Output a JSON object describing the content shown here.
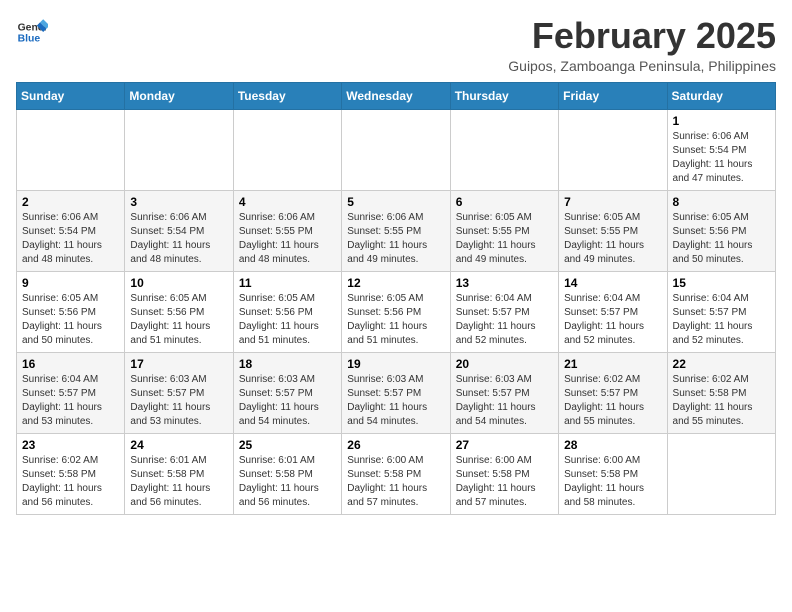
{
  "header": {
    "logo_line1": "General",
    "logo_line2": "Blue",
    "month_title": "February 2025",
    "subtitle": "Guipos, Zamboanga Peninsula, Philippines"
  },
  "weekdays": [
    "Sunday",
    "Monday",
    "Tuesday",
    "Wednesday",
    "Thursday",
    "Friday",
    "Saturday"
  ],
  "weeks": [
    [
      {
        "day": "",
        "info": ""
      },
      {
        "day": "",
        "info": ""
      },
      {
        "day": "",
        "info": ""
      },
      {
        "day": "",
        "info": ""
      },
      {
        "day": "",
        "info": ""
      },
      {
        "day": "",
        "info": ""
      },
      {
        "day": "1",
        "info": "Sunrise: 6:06 AM\nSunset: 5:54 PM\nDaylight: 11 hours\nand 47 minutes."
      }
    ],
    [
      {
        "day": "2",
        "info": "Sunrise: 6:06 AM\nSunset: 5:54 PM\nDaylight: 11 hours\nand 48 minutes."
      },
      {
        "day": "3",
        "info": "Sunrise: 6:06 AM\nSunset: 5:54 PM\nDaylight: 11 hours\nand 48 minutes."
      },
      {
        "day": "4",
        "info": "Sunrise: 6:06 AM\nSunset: 5:55 PM\nDaylight: 11 hours\nand 48 minutes."
      },
      {
        "day": "5",
        "info": "Sunrise: 6:06 AM\nSunset: 5:55 PM\nDaylight: 11 hours\nand 49 minutes."
      },
      {
        "day": "6",
        "info": "Sunrise: 6:05 AM\nSunset: 5:55 PM\nDaylight: 11 hours\nand 49 minutes."
      },
      {
        "day": "7",
        "info": "Sunrise: 6:05 AM\nSunset: 5:55 PM\nDaylight: 11 hours\nand 49 minutes."
      },
      {
        "day": "8",
        "info": "Sunrise: 6:05 AM\nSunset: 5:56 PM\nDaylight: 11 hours\nand 50 minutes."
      }
    ],
    [
      {
        "day": "9",
        "info": "Sunrise: 6:05 AM\nSunset: 5:56 PM\nDaylight: 11 hours\nand 50 minutes."
      },
      {
        "day": "10",
        "info": "Sunrise: 6:05 AM\nSunset: 5:56 PM\nDaylight: 11 hours\nand 51 minutes."
      },
      {
        "day": "11",
        "info": "Sunrise: 6:05 AM\nSunset: 5:56 PM\nDaylight: 11 hours\nand 51 minutes."
      },
      {
        "day": "12",
        "info": "Sunrise: 6:05 AM\nSunset: 5:56 PM\nDaylight: 11 hours\nand 51 minutes."
      },
      {
        "day": "13",
        "info": "Sunrise: 6:04 AM\nSunset: 5:57 PM\nDaylight: 11 hours\nand 52 minutes."
      },
      {
        "day": "14",
        "info": "Sunrise: 6:04 AM\nSunset: 5:57 PM\nDaylight: 11 hours\nand 52 minutes."
      },
      {
        "day": "15",
        "info": "Sunrise: 6:04 AM\nSunset: 5:57 PM\nDaylight: 11 hours\nand 52 minutes."
      }
    ],
    [
      {
        "day": "16",
        "info": "Sunrise: 6:04 AM\nSunset: 5:57 PM\nDaylight: 11 hours\nand 53 minutes."
      },
      {
        "day": "17",
        "info": "Sunrise: 6:03 AM\nSunset: 5:57 PM\nDaylight: 11 hours\nand 53 minutes."
      },
      {
        "day": "18",
        "info": "Sunrise: 6:03 AM\nSunset: 5:57 PM\nDaylight: 11 hours\nand 54 minutes."
      },
      {
        "day": "19",
        "info": "Sunrise: 6:03 AM\nSunset: 5:57 PM\nDaylight: 11 hours\nand 54 minutes."
      },
      {
        "day": "20",
        "info": "Sunrise: 6:03 AM\nSunset: 5:57 PM\nDaylight: 11 hours\nand 54 minutes."
      },
      {
        "day": "21",
        "info": "Sunrise: 6:02 AM\nSunset: 5:57 PM\nDaylight: 11 hours\nand 55 minutes."
      },
      {
        "day": "22",
        "info": "Sunrise: 6:02 AM\nSunset: 5:58 PM\nDaylight: 11 hours\nand 55 minutes."
      }
    ],
    [
      {
        "day": "23",
        "info": "Sunrise: 6:02 AM\nSunset: 5:58 PM\nDaylight: 11 hours\nand 56 minutes."
      },
      {
        "day": "24",
        "info": "Sunrise: 6:01 AM\nSunset: 5:58 PM\nDaylight: 11 hours\nand 56 minutes."
      },
      {
        "day": "25",
        "info": "Sunrise: 6:01 AM\nSunset: 5:58 PM\nDaylight: 11 hours\nand 56 minutes."
      },
      {
        "day": "26",
        "info": "Sunrise: 6:00 AM\nSunset: 5:58 PM\nDaylight: 11 hours\nand 57 minutes."
      },
      {
        "day": "27",
        "info": "Sunrise: 6:00 AM\nSunset: 5:58 PM\nDaylight: 11 hours\nand 57 minutes."
      },
      {
        "day": "28",
        "info": "Sunrise: 6:00 AM\nSunset: 5:58 PM\nDaylight: 11 hours\nand 58 minutes."
      },
      {
        "day": "",
        "info": ""
      }
    ]
  ]
}
